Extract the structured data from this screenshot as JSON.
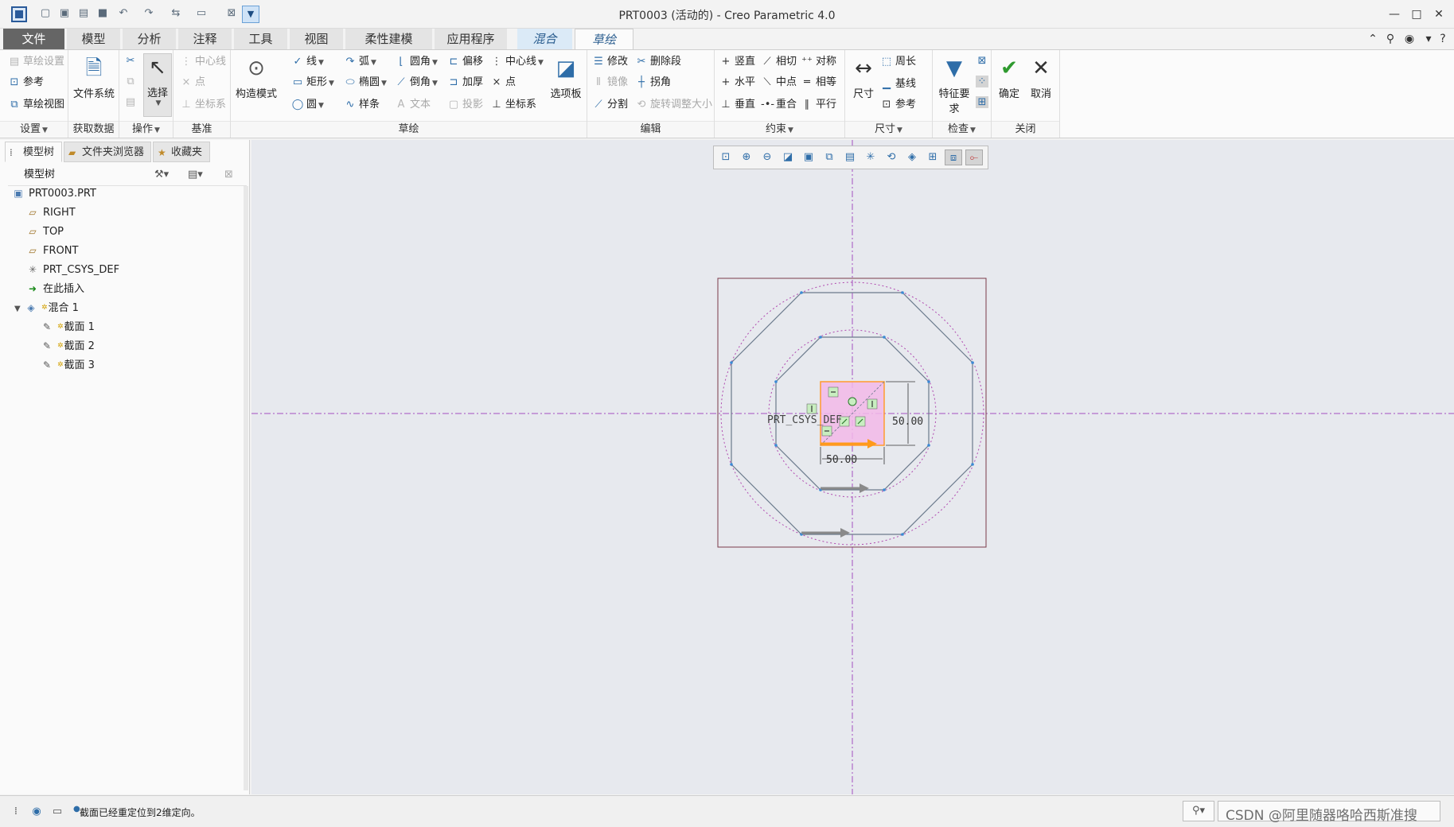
{
  "window": {
    "title": "PRT0003 (活动的) - Creo Parametric 4.0",
    "quick_access_icons": [
      "new-icon",
      "open-icon",
      "save-icon",
      "undo-icon",
      "redo-icon",
      "regenerate-icon",
      "windows-icon",
      "close-window-icon"
    ]
  },
  "menu": {
    "tabs": [
      "文件",
      "模型",
      "分析",
      "注释",
      "工具",
      "视图",
      "柔性建模",
      "应用程序",
      "混合",
      "草绘"
    ],
    "active_tab": "草绘"
  },
  "ribbon": {
    "setup": {
      "label": "设置",
      "items": [
        "草绘设置",
        "参考",
        "草绘视图"
      ]
    },
    "get_data": {
      "label": "获取数据",
      "items": [
        "文件系统"
      ]
    },
    "operations": {
      "label": "操作",
      "items": [
        "选择"
      ]
    },
    "datum": {
      "label": "基准",
      "items": [
        "中心线",
        "点",
        "坐标系"
      ]
    },
    "sketching": {
      "label": "草绘",
      "construction_mode": "构造模式",
      "items": [
        "线",
        "弧",
        "圆角",
        "偏移",
        "中心线",
        "矩形",
        "椭圆",
        "倒角",
        "加厚",
        "点",
        "圆",
        "样条",
        "文本",
        "投影",
        "坐标系"
      ],
      "palette": "选项板"
    },
    "editing": {
      "label": "编辑",
      "items": [
        "修改",
        "删除段",
        "镜像",
        "拐角",
        "分割",
        "旋转调整大小"
      ]
    },
    "constrain": {
      "label": "约束",
      "items": [
        "竖直",
        "相切",
        "对称",
        "水平",
        "中点",
        "相等",
        "垂直",
        "重合",
        "平行"
      ]
    },
    "dimension": {
      "label": "尺寸",
      "items": [
        "尺寸",
        "周长",
        "基线",
        "参考"
      ]
    },
    "inspect": {
      "label": "检查",
      "items": [
        "特征要求"
      ]
    },
    "close": {
      "label": "关闭",
      "items": [
        "确定",
        "取消"
      ]
    }
  },
  "panel": {
    "tabs": [
      "模型树",
      "文件夹浏览器",
      "收藏夹"
    ],
    "tree_header": "模型树",
    "tree": [
      {
        "label": "PRT0003.PRT",
        "icon": "part-icon",
        "indent": 0
      },
      {
        "label": "RIGHT",
        "icon": "datum-plane-icon",
        "indent": 1
      },
      {
        "label": "TOP",
        "icon": "datum-plane-icon",
        "indent": 1
      },
      {
        "label": "FRONT",
        "icon": "datum-plane-icon",
        "indent": 1
      },
      {
        "label": "PRT_CSYS_DEF",
        "icon": "csys-icon",
        "indent": 1
      },
      {
        "label": "在此插入",
        "icon": "insert-here-icon",
        "indent": 1
      },
      {
        "label": "混合 1",
        "icon": "blend-feature-icon",
        "indent": 1
      },
      {
        "label": "截面 1",
        "icon": "sketch-section-icon",
        "indent": 2
      },
      {
        "label": "截面 2",
        "icon": "sketch-section-icon",
        "indent": 2
      },
      {
        "label": "截面 3",
        "icon": "sketch-section-icon",
        "indent": 2
      }
    ]
  },
  "sketch": {
    "csys_label": "PRT_CSYS_DEF",
    "dim_vertical": "50.00",
    "dim_horizontal": "50.00"
  },
  "status": {
    "message": "截面已经重定位到2维定向。",
    "watermark": "CSDN @阿里随器咯哈西斯准搜"
  },
  "colors": {
    "accent": "#2e6da8",
    "sketch_line": "#6b7a8c",
    "highlight_fill": "#f2b8e8",
    "highlight_edge": "#ff9a2e",
    "centerline": "#a34fc0"
  }
}
